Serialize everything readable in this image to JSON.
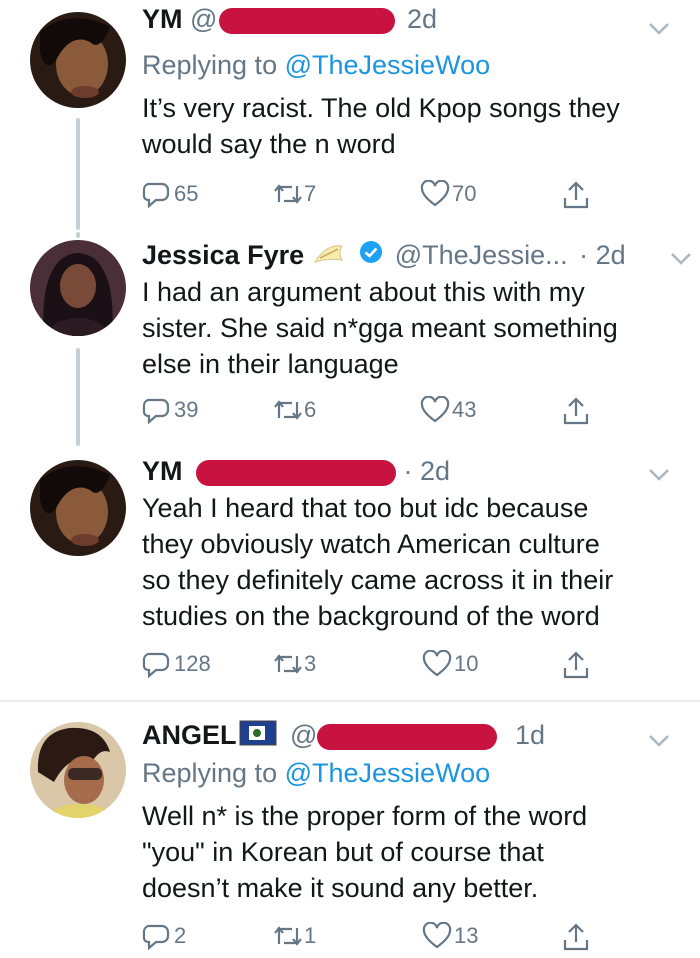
{
  "tweets": [
    {
      "name": "YM",
      "handle_prefix": "@",
      "time": "2d",
      "replying_label": "Replying to",
      "replying_handle": "@TheJessieWoo",
      "text_lines": [
        "It’s very racist. The old Kpop songs they",
        "would say the n word"
      ],
      "replies": "65",
      "retweets": "7",
      "likes": "70"
    },
    {
      "name": "Jessica Fyre",
      "handle": "@TheJessie...",
      "time": "· 2d",
      "text_lines": [
        "I had an argument about this with my",
        "sister. She said n*gga meant something",
        "else in their language"
      ],
      "replies": "39",
      "retweets": "6",
      "likes": "43"
    },
    {
      "name": "YM",
      "time": "· 2d",
      "text_lines": [
        "Yeah I heard that too but idc because",
        "they obviously watch American culture",
        "so they definitely came across it in their",
        "studies on the background of the word"
      ],
      "replies": "128",
      "retweets": "3",
      "likes": "10"
    },
    {
      "name": "ANGEL",
      "time": "1d",
      "replying_label": "Replying to",
      "replying_handle": "@TheJessieWoo",
      "text_lines": [
        "Well n* is the proper form of the word",
        "\"you\" in Korean but of course that",
        "doesn’t make it sound any better."
      ],
      "replies": "2",
      "retweets": "1",
      "likes": "13"
    }
  ],
  "colors": {
    "link": "#1b95e0",
    "muted": "#657786",
    "redaction": "#c8123f",
    "verified": "#1da1f2"
  },
  "icons": [
    "reply-icon",
    "retweet-icon",
    "like-icon",
    "share-icon",
    "chevron-down-icon",
    "verified-badge-icon",
    "flag-icon"
  ]
}
